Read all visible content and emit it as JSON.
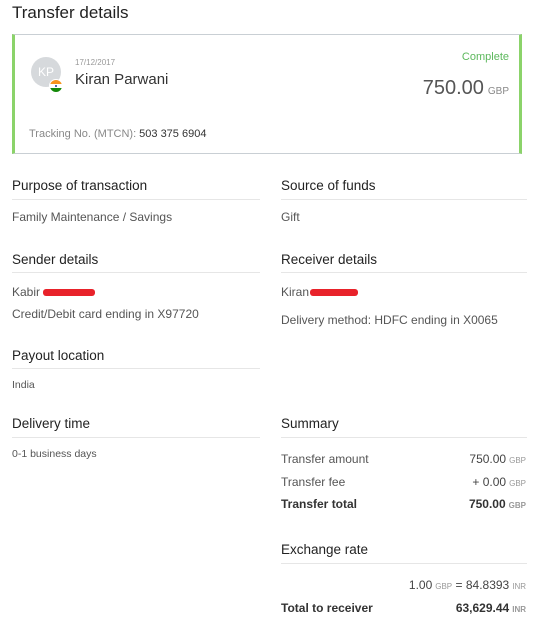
{
  "page_title": "Transfer details",
  "card": {
    "avatar_initials": "KP",
    "date": "17/12/2017",
    "name": "Kiran Parwani",
    "status": "Complete",
    "amount": "750.00",
    "currency": "GBP",
    "tracking_label": "Tracking No. (MTCN):",
    "tracking_number": "503 375 6904",
    "status_color": "#5cb85c",
    "accent_color": "#8bd36a"
  },
  "purpose": {
    "heading": "Purpose of transaction",
    "value": "Family Maintenance / Savings"
  },
  "source": {
    "heading": "Source of funds",
    "value": "Gift"
  },
  "sender": {
    "heading": "Sender details",
    "name": "Kabir",
    "card": "Credit/Debit card ending in X97720"
  },
  "receiver": {
    "heading": "Receiver details",
    "name": "Kiran",
    "delivery": "Delivery method: HDFC  ending in X0065"
  },
  "payout": {
    "heading": "Payout location",
    "value": "India"
  },
  "delivery_time": {
    "heading": "Delivery time",
    "value": "0-1 business days"
  },
  "summary": {
    "heading": "Summary",
    "rows": [
      {
        "label": "Transfer amount",
        "value": "750.00",
        "currency": "GBP"
      },
      {
        "label": "Transfer fee",
        "value": "+ 0.00",
        "currency": "GBP"
      },
      {
        "label": "Transfer total",
        "value": "750.00",
        "currency": "GBP"
      }
    ]
  },
  "exchange": {
    "heading": "Exchange rate",
    "rate_lhs": "1.00",
    "rate_lhs_cur": "GBP",
    "rate_rhs": "= 84.8393",
    "rate_rhs_cur": "INR",
    "total_label": "Total to receiver",
    "total_value": "63,629.44",
    "total_cur": "INR"
  }
}
